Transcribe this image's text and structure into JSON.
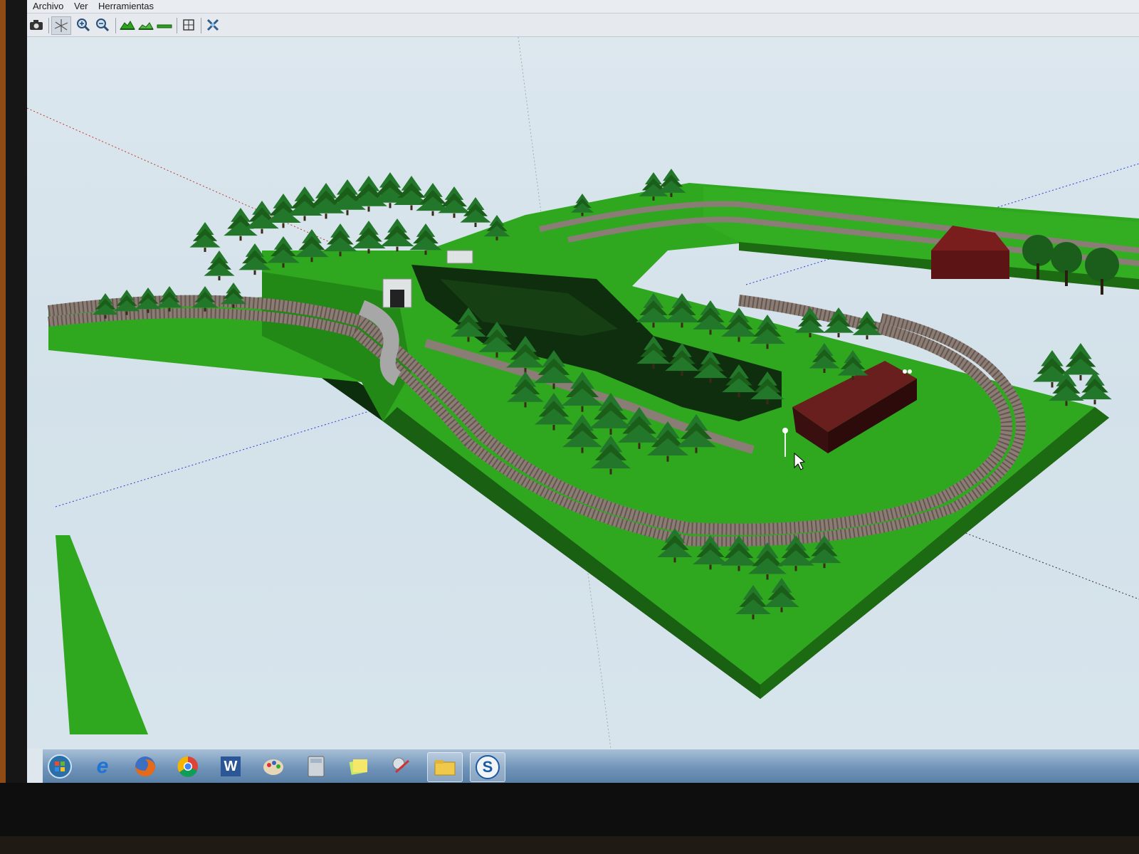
{
  "menu": {
    "items": [
      {
        "label": "Archivo"
      },
      {
        "label": "Ver"
      },
      {
        "label": "Herramientas"
      }
    ]
  },
  "toolbar": {
    "buttons": [
      {
        "icon": "camera-icon"
      },
      {
        "icon": "pan-axes-icon"
      },
      {
        "icon": "zoom-in-icon"
      },
      {
        "icon": "zoom-out-icon"
      },
      {
        "icon": "terrain-raise-icon"
      },
      {
        "icon": "terrain-lower-icon"
      },
      {
        "icon": "terrain-flat-icon"
      },
      {
        "icon": "grid-icon"
      },
      {
        "icon": "tools-icon"
      }
    ]
  },
  "taskbar": {
    "items": [
      {
        "icon": "windows-start-icon"
      },
      {
        "icon": "internet-explorer-icon",
        "label": "e"
      },
      {
        "icon": "firefox-icon"
      },
      {
        "icon": "chrome-icon"
      },
      {
        "icon": "word-icon",
        "label": "W"
      },
      {
        "icon": "paint-icon"
      },
      {
        "icon": "calculator-icon"
      },
      {
        "icon": "sticky-notes-icon"
      },
      {
        "icon": "snipping-tool-icon"
      },
      {
        "icon": "file-explorer-icon"
      },
      {
        "icon": "skype-icon",
        "label": "S"
      }
    ]
  },
  "colors": {
    "grass": "#2fa81f",
    "grass_dark": "#1d6d14",
    "track": "#8a7d76",
    "tree": "#1e6a1e",
    "building": "#4a1616",
    "sky": "#dce7ee"
  }
}
